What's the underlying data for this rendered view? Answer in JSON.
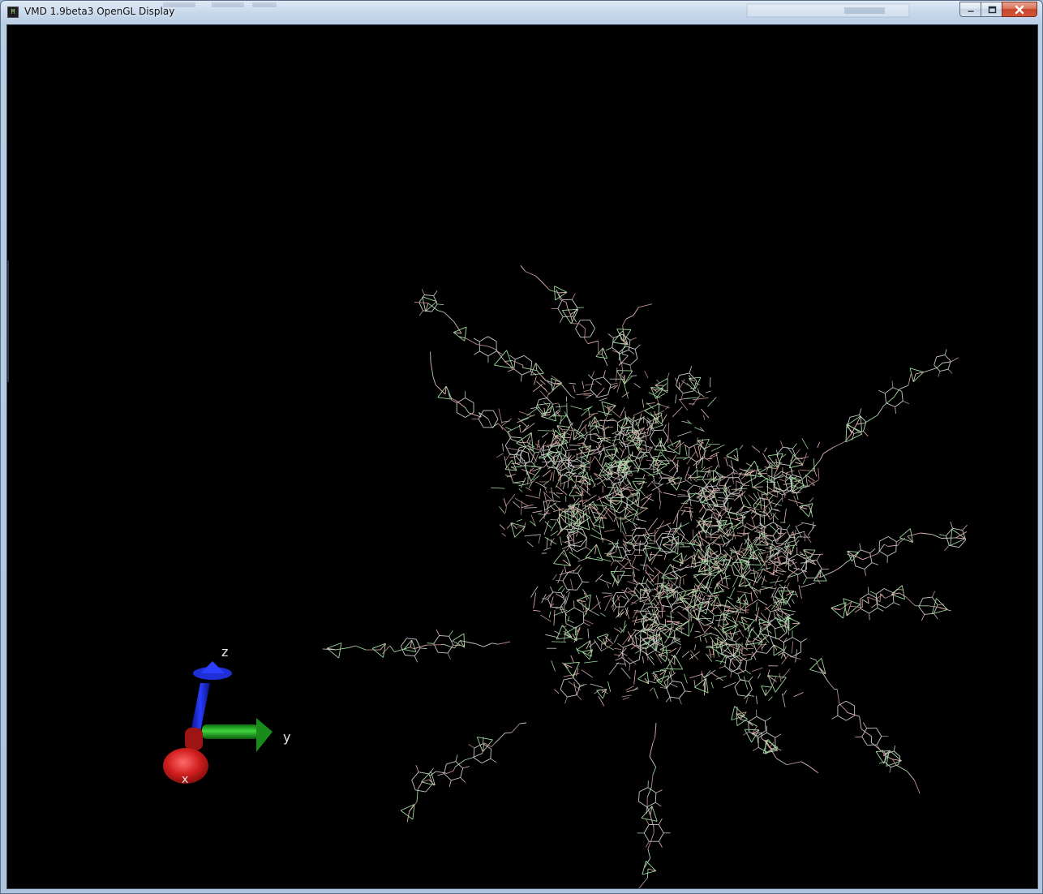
{
  "window": {
    "title": "VMD 1.9beta3 OpenGL Display",
    "app_icon_glyph": "M",
    "buttons": {
      "minimize_icon": "minimize-icon",
      "maximize_icon": "maximize-icon",
      "close_icon": "close-icon"
    }
  },
  "display": {
    "background_color": "#000000",
    "representation": "Lines",
    "bond_colors": [
      "#b98c8c",
      "#e8b4b4",
      "#9fd89f",
      "#c8c8c8"
    ]
  },
  "axes": {
    "z_label": "z",
    "y_label": "y",
    "x_label": "x",
    "colors": {
      "x": "#cc1f1f",
      "y": "#1fb31f",
      "z": "#1f2fd6"
    }
  }
}
